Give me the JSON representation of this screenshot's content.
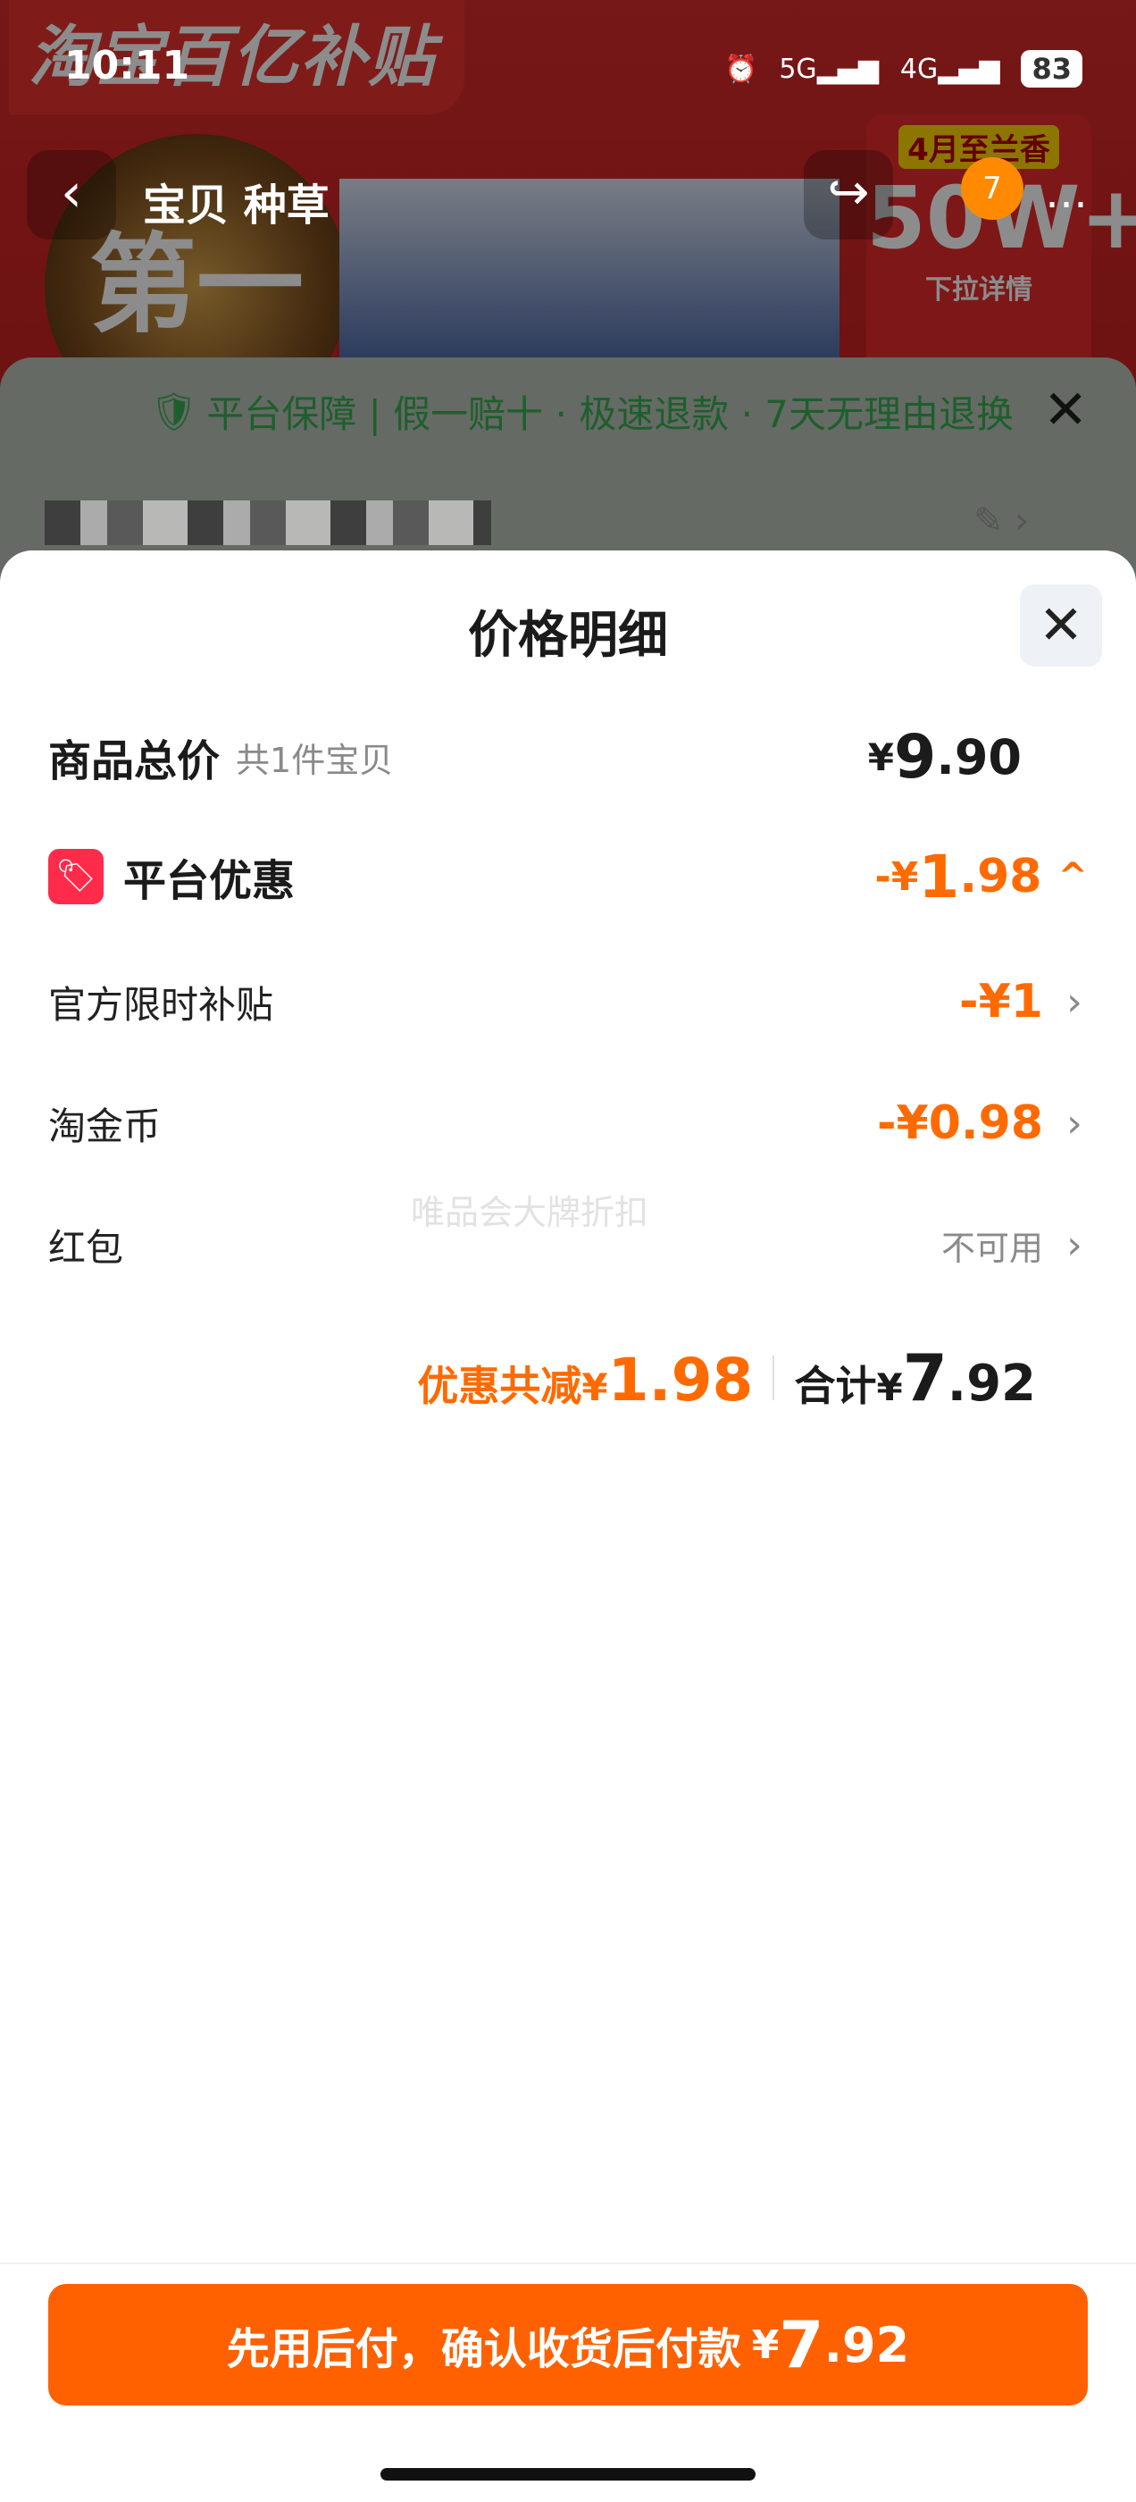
{
  "status_bar": {
    "time": "10:11",
    "signal_1": "5G",
    "signal_2": "4G",
    "battery": "83"
  },
  "background": {
    "brand": "淘宝百亿补贴",
    "promo_line1": "4月至兰香",
    "promo_big": "50W+",
    "promo_line3": "下拉详情",
    "medal_text": "第一",
    "nav_tabs": "宝贝  种草",
    "nav_badge": "7",
    "guarantee_text": "平台保障 | 假一赔十 · 极速退款 · 7天无理由退换"
  },
  "sheet": {
    "title": "价格明细",
    "goods_total": {
      "label": "商品总价",
      "sub": "共1件宝贝",
      "sym": "¥",
      "int": "9",
      "dec": ".90"
    },
    "platform_discount": {
      "label": "平台优惠",
      "amount_prefix": "-¥",
      "int": "1",
      "dec": ".98"
    },
    "items": [
      {
        "label": "官方限时补贴",
        "value": "-¥1"
      },
      {
        "label": "淘金币",
        "value": "-¥0.98"
      },
      {
        "label": "红包",
        "value": "不可用"
      }
    ],
    "watermark": "唯品会大牌折扣",
    "summary": {
      "discount_label": "优惠共减",
      "discount_sym": "¥",
      "discount_value": "1.98",
      "total_label": "合计",
      "total_sym": "¥",
      "total_int": "7",
      "total_dec": ".92"
    },
    "pay_button": {
      "label": "先用后付，确认收货后付款",
      "sym": "¥",
      "int": "7",
      "dec": ".92"
    }
  },
  "colors": {
    "accent": "#ff6a00",
    "button": "#ff6000",
    "tag": "#ff2b4a"
  }
}
